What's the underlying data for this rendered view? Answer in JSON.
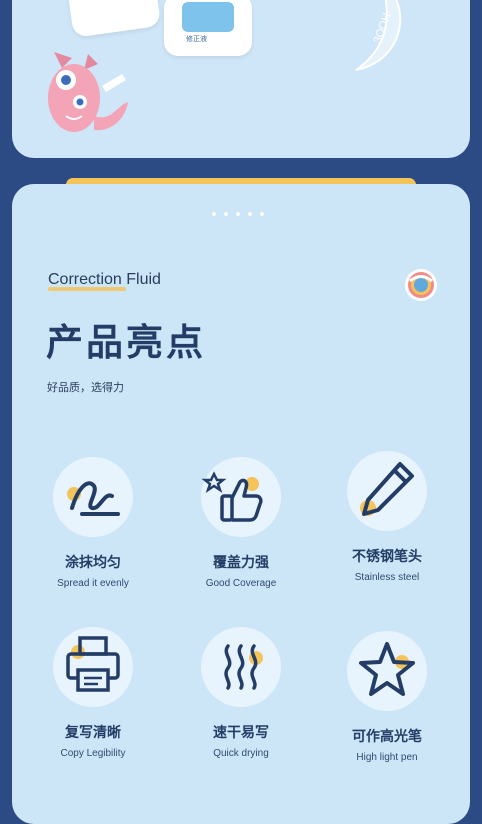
{
  "hero": {
    "bottle_label": "修正液",
    "moon_text": "3OOH"
  },
  "section": {
    "brand": "Correction Fluid",
    "title": "产品亮点",
    "subtitle": "好品质，选得力"
  },
  "features": [
    {
      "cn": "涂抹均匀",
      "en": "Spread it evenly",
      "icon": "pen-stroke-icon"
    },
    {
      "cn": "覆盖力强",
      "en": "Good Coverage",
      "icon": "thumbs-up-icon"
    },
    {
      "cn": "不锈钢笔头",
      "en": "Stainless steel",
      "icon": "pencil-icon"
    },
    {
      "cn": "复写清晰",
      "en": "Copy Legibility",
      "icon": "printer-icon"
    },
    {
      "cn": "速干易写",
      "en": "Quick drying",
      "icon": "heat-waves-icon"
    },
    {
      "cn": "可作高光笔",
      "en": "High light pen",
      "icon": "star-icon"
    }
  ],
  "colors": {
    "background": "#2c4a84",
    "card": "#cce6f8",
    "accent": "#f4c45a",
    "ink": "#233d66"
  }
}
